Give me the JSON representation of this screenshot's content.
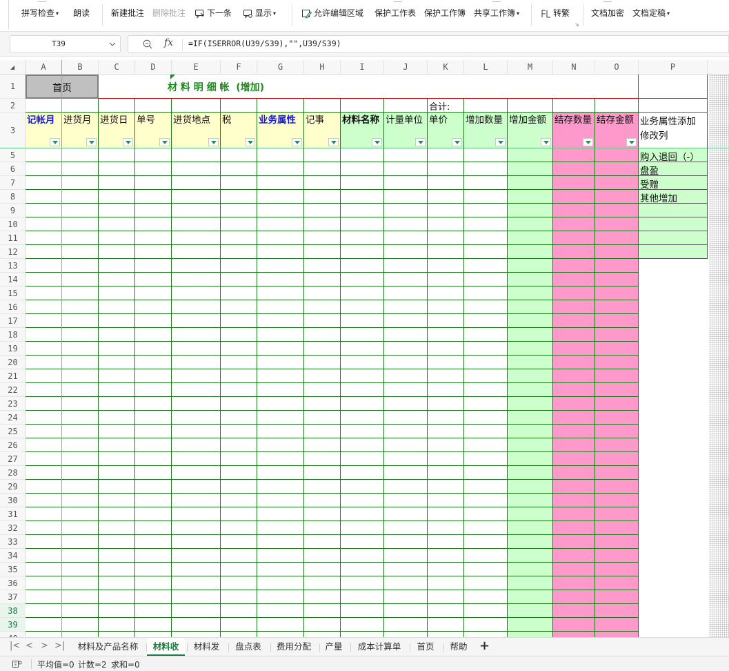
{
  "ribbon": {
    "spell_check": "拼写检查",
    "read_aloud": "朗读",
    "new_comment": "新建批注",
    "delete_comment": "删除批注",
    "next_item": "下一条",
    "show": "显示",
    "allow_edit_ranges": "允许编辑区域",
    "protect_sheet": "保护工作表",
    "protect_workbook": "保护工作簿",
    "share_workbook": "共享工作簿",
    "convert_trad_simp": "转繁",
    "encrypt_document": "文档加密",
    "finalize_document": "文档定稿"
  },
  "formula_bar": {
    "cell_ref": "T39",
    "fx_label": "fx",
    "formula": "=IF(ISERROR(U39/S39),\"\",U39/S39)"
  },
  "columns": [
    "A",
    "B",
    "C",
    "D",
    "E",
    "F",
    "G",
    "H",
    "I",
    "J",
    "K",
    "L",
    "M",
    "N",
    "O",
    "P"
  ],
  "rows": [
    "1",
    "2",
    "3",
    "5",
    "6",
    "7",
    "8",
    "9",
    "10",
    "11",
    "12",
    "13",
    "14",
    "15",
    "16",
    "17",
    "18",
    "19",
    "20",
    "21",
    "22",
    "23",
    "24",
    "25",
    "26",
    "27",
    "28",
    "29",
    "30",
    "31",
    "32",
    "33",
    "34",
    "35",
    "36",
    "37",
    "38",
    "39",
    "40"
  ],
  "selected_rows": [
    "38",
    "39"
  ],
  "sheet": {
    "home_button": "首页",
    "title": "材 料 明 细 帐  (增加)",
    "total_label": "合计:",
    "headers": [
      "记帐月",
      "进货月",
      "进货日",
      "单号",
      "进货地点",
      "税",
      "业务属性",
      "记事",
      "材料名称",
      "计量单位",
      "单价",
      "增加数量",
      "增加金额",
      "结存数量",
      "结存金额"
    ],
    "p_header": "业务属性添加修改列",
    "p_list": [
      "购入退回（-）",
      "盘盈",
      "受赠",
      "其他增加"
    ]
  },
  "colors": {
    "yellow": "#ffffcc",
    "green": "#ccffcc",
    "pink": "#ff99cc",
    "grid_green": "#1b7a1b",
    "title_green": "#1b8a1b",
    "header_blue": "#1a1adb",
    "accent": "#1d7a3e"
  },
  "sheet_tabs": [
    "材料及产品名称",
    "材料收",
    "材料发",
    "盘点表",
    "费用分配",
    "产量",
    "成本计算单",
    "首页",
    "帮助"
  ],
  "active_tab": "材料收",
  "add_sheet": "+",
  "status": {
    "average": "平均值=0",
    "count": "计数=2",
    "sum": "求和=0"
  }
}
